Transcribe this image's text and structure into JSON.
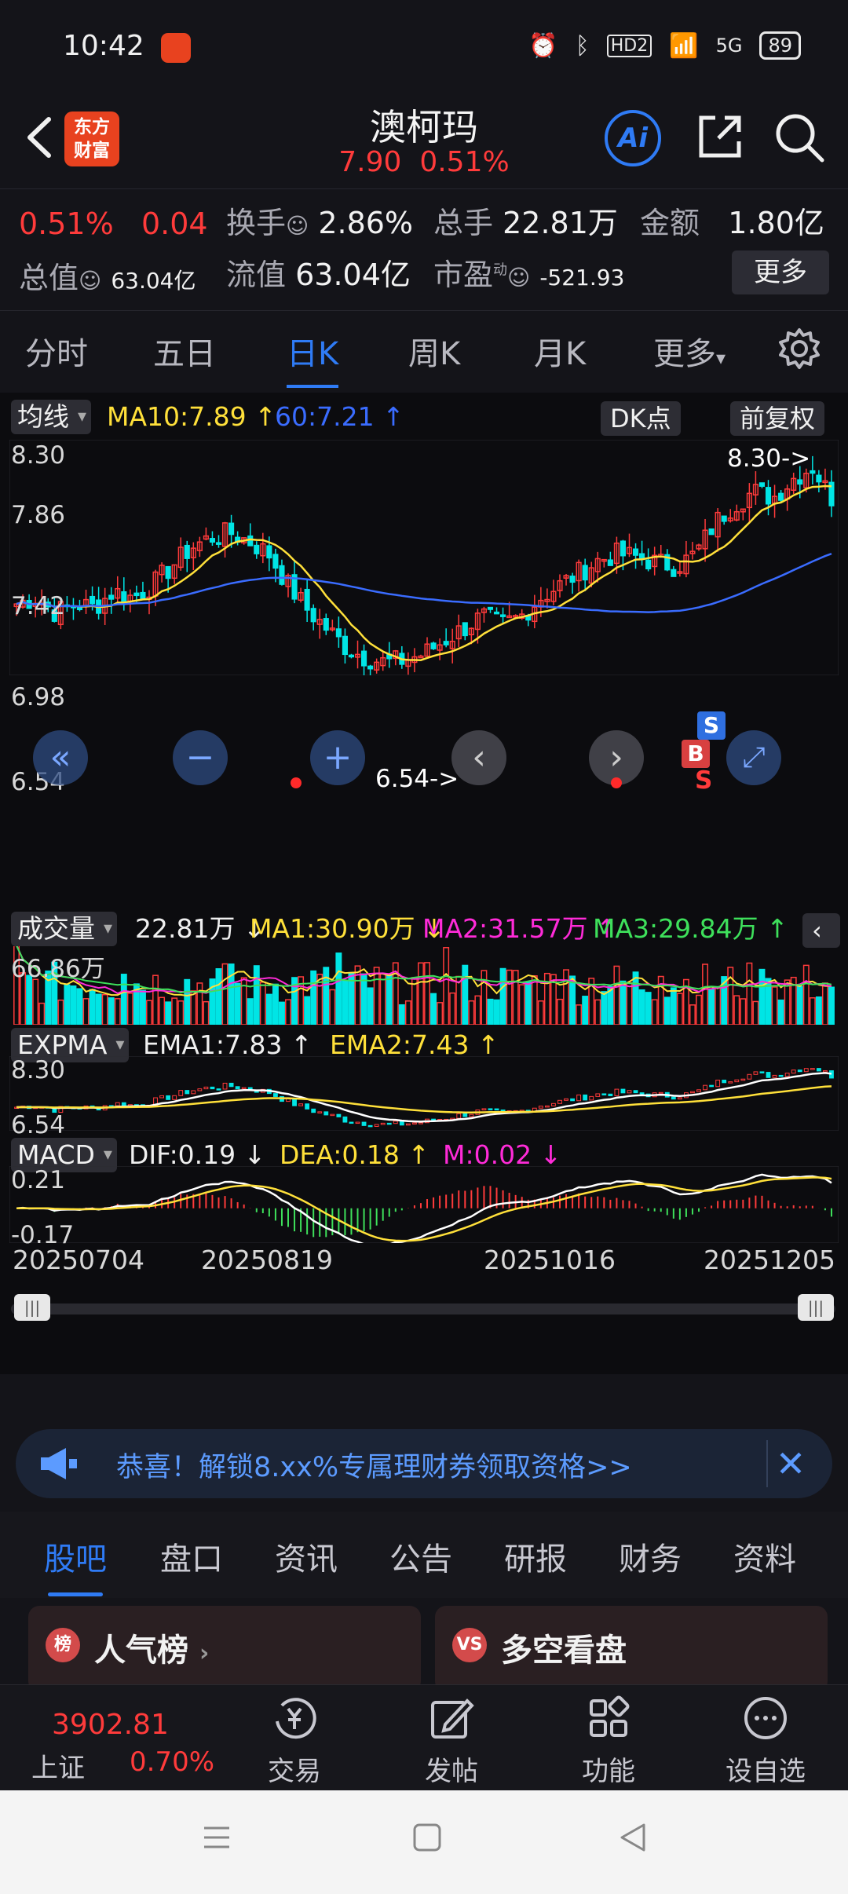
{
  "status_bar": {
    "time": "10:42",
    "network": "HD2",
    "signal": "5G",
    "battery": "89"
  },
  "header": {
    "logo_line1": "东方",
    "logo_line2": "财富",
    "stock_name": "澳柯玛",
    "price": "7.90",
    "change_pct": "0.51%",
    "ai_label": "Ai"
  },
  "stats": {
    "pct": "0.51%",
    "change": "0.04",
    "turnover_label": "换手",
    "turnover": "2.86%",
    "volume_label": "总手",
    "volume": "22.81万",
    "amount_label": "金额",
    "amount": "1.80亿",
    "mktcap_label": "总值",
    "mktcap": "63.04亿",
    "float_label": "流值",
    "float": "63.04亿",
    "pe_label": "市盈",
    "pe_sup": "动",
    "pe": "-521.93",
    "more_btn": "更多"
  },
  "period_tabs": [
    "分时",
    "五日",
    "日K",
    "周K",
    "月K",
    "更多"
  ],
  "period_active": "日K",
  "kline": {
    "ma_selector": "均线",
    "ma10": "MA10:7.89",
    "ma60": "60:7.21",
    "dk_btn": "DK点",
    "adj_btn": "前复权",
    "y_top": "8.30",
    "y_2": "7.86",
    "y_3": "7.42",
    "y_4": "6.98",
    "y_bottom": "6.54",
    "max_label": "8.30->",
    "min_label": "6.54->",
    "buy_mark": "B",
    "sell_mark": "S",
    "sell_mark2": "S"
  },
  "volume": {
    "selector": "成交量",
    "value": "22.81万",
    "ma1": "MA1:30.90万",
    "ma2": "MA2:31.57万",
    "ma3": "MA3:29.84万",
    "y_top": "66.86万"
  },
  "expma": {
    "selector": "EXPMA",
    "ema1": "EMA1:7.83",
    "ema2": "EMA2:7.43",
    "y_top": "8.30",
    "y_bottom": "6.54"
  },
  "macd": {
    "selector": "MACD",
    "dif": "DIF:0.19",
    "dea": "DEA:0.18",
    "m": "M:0.02",
    "y_top": "0.21",
    "y_bottom": "-0.17"
  },
  "dates": [
    "20250704",
    "20250819",
    "20251016",
    "20251205"
  ],
  "promo": {
    "text": "恭喜！解锁8.xx%专属理财券领取资格>>"
  },
  "sub_tabs": [
    "股吧",
    "盘口",
    "资讯",
    "公告",
    "研报",
    "财务",
    "资料"
  ],
  "sub_active": "股吧",
  "cards": [
    {
      "title": "人气榜",
      "icon": "榜"
    },
    {
      "title": "多空看盘",
      "icon": "VS"
    }
  ],
  "bottom_bar": {
    "index_value": "3902.81",
    "index_name": "上证",
    "index_pct": "0.70%",
    "items": [
      "交易",
      "发帖",
      "功能",
      "设自选"
    ]
  },
  "colors": {
    "up": "#ff3b3b",
    "down": "#00e5e5",
    "accent": "#2f7bf5",
    "ma_yellow": "#ffe03a",
    "ma_blue": "#3a6cff"
  },
  "chart_data": {
    "type": "candlestick",
    "x_start": "20250704",
    "x_end": "20251205",
    "ylim": [
      6.54,
      8.3
    ],
    "close_approx": [
      7.05,
      7.1,
      6.98,
      7.05,
      7.02,
      7.15,
      7.1,
      7.2,
      7.35,
      7.5,
      7.58,
      7.62,
      7.55,
      7.45,
      7.2,
      7.0,
      6.85,
      6.7,
      6.62,
      6.58,
      6.6,
      6.65,
      6.75,
      6.85,
      6.95,
      6.88,
      6.95,
      7.1,
      7.2,
      7.3,
      7.4,
      7.45,
      7.42,
      7.38,
      7.35,
      7.45,
      7.7,
      7.85,
      7.95,
      7.9,
      8.05,
      8.15,
      7.9
    ]
  }
}
